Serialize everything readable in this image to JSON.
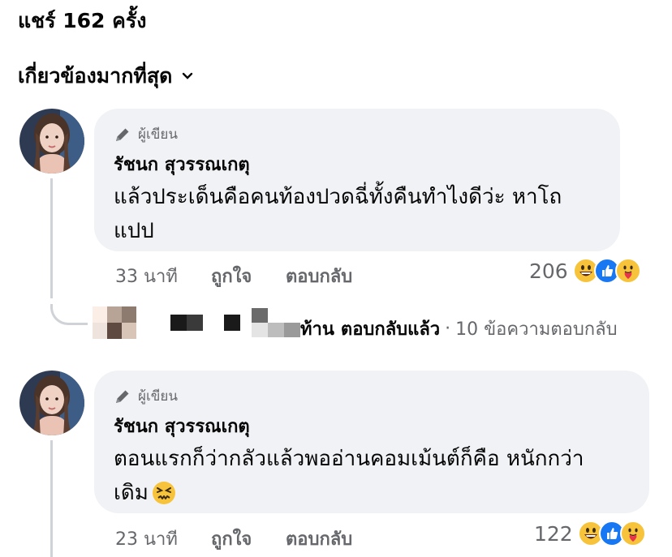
{
  "header": {
    "shares_text": "แชร์ 162 ครั้ง",
    "sort_label": "เกี่ยวข้องมากที่สุด"
  },
  "comments": [
    {
      "badge": "ผู้เขียน",
      "author": "รัชนก สุวรรณเกตุ",
      "text_line1": "แล้วประเด็นคือคนท้องปวดฉี่ทั้งคืนทำไงดีว่ะ หาโถ",
      "text_line2": "แปป",
      "time": "33 นาที",
      "like": "ถูกใจ",
      "reply": "ตอบกลับ",
      "reaction_count": "206",
      "replies_summary": {
        "name_fragment": "ท้าน",
        "action": "ตอบกลับแล้ว",
        "separator": "·",
        "count_text": "10 ข้อความตอบกลับ"
      }
    },
    {
      "badge": "ผู้เขียน",
      "author": "รัชนก สุวรรณเกตุ",
      "text_line1": "ตอนแรกก็ว่ากลัวแล้วพออ่านคอมเม้นต์ก็คือ หนักกว่า",
      "text_line2": "เดิม",
      "time": "23 นาที",
      "like": "ถูกใจ",
      "reply": "ตอบกลับ",
      "reaction_count": "122"
    }
  ],
  "icons": {
    "badge_icon": "pen-icon",
    "sort_icon": "chevron-down-icon",
    "reaction_icons": [
      "grinning-emoji-icon",
      "like-icon",
      "care-emoji-icon"
    ],
    "inline_emoji": "confounded-emoji-icon"
  },
  "colors": {
    "bubble": "#f0f2f5",
    "muted_text": "#65676b",
    "like_blue": "#1877f2",
    "emoji_yellow": "#f7c33b"
  }
}
